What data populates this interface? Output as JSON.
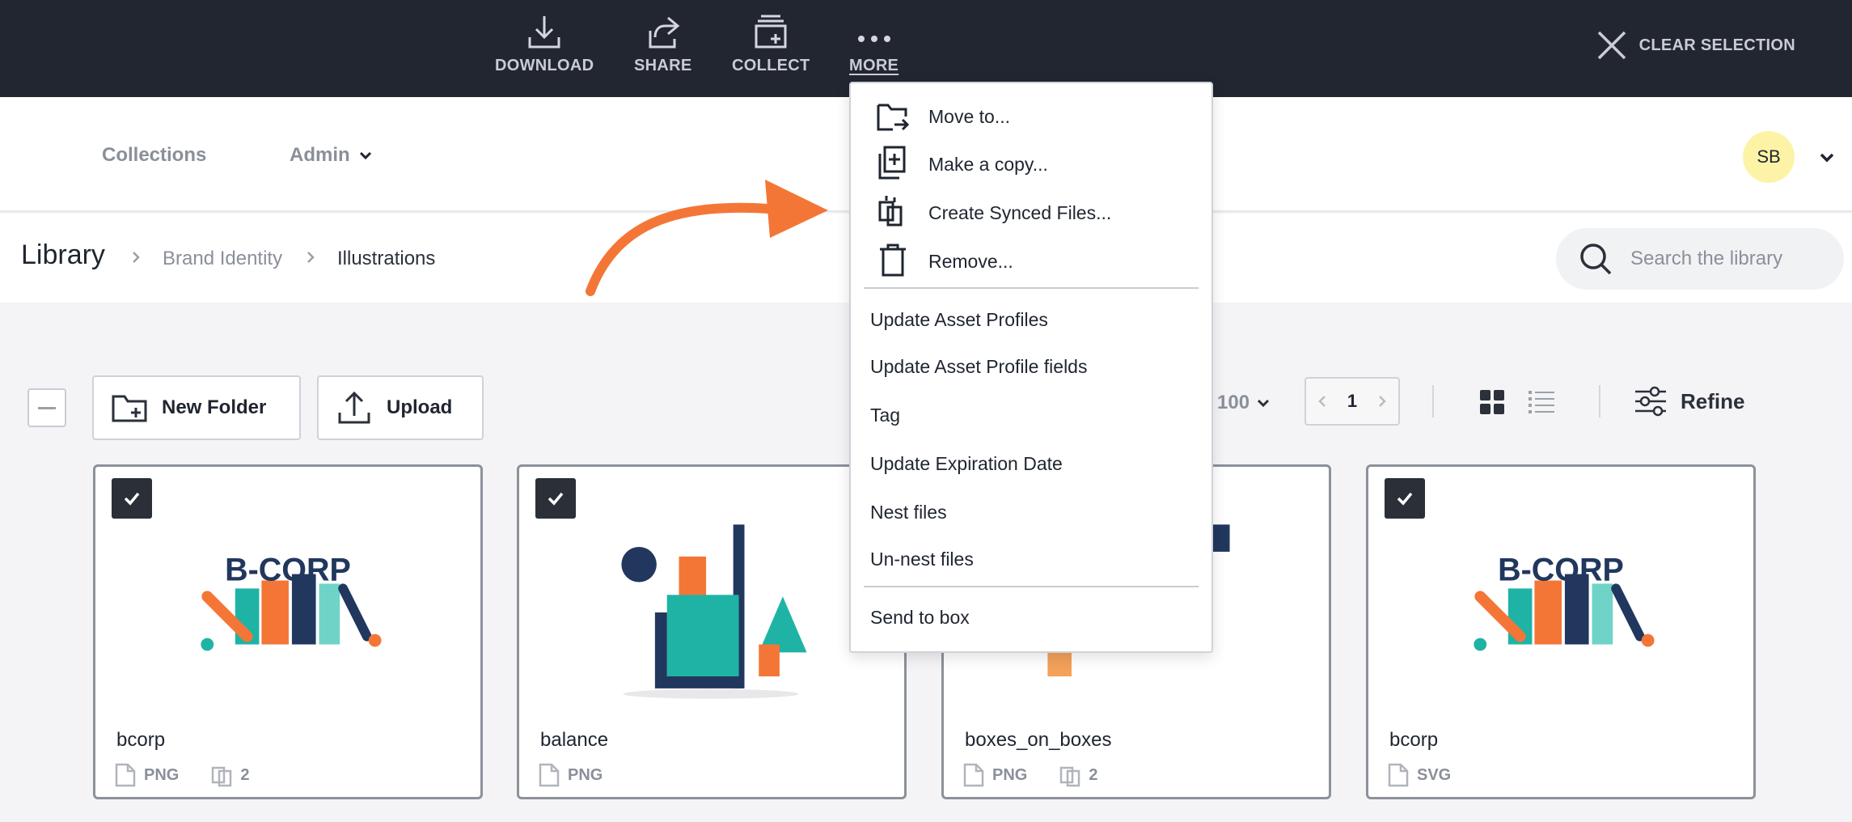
{
  "topbar": {
    "actions": {
      "download": "DOWNLOAD",
      "share": "SHARE",
      "collect": "COLLECT",
      "more": "MORE"
    },
    "clear_selection": "CLEAR SELECTION"
  },
  "nav": {
    "collections": "Collections",
    "admin": "Admin",
    "user_initials": "SB"
  },
  "breadcrumb": {
    "root": "Library",
    "parent": "Brand Identity",
    "current": "Illustrations"
  },
  "search": {
    "placeholder": "Search the library"
  },
  "toolbar": {
    "new_folder": "New Folder",
    "upload": "Upload",
    "per_page": "100",
    "page": "1",
    "refine": "Refine"
  },
  "menu": {
    "items": {
      "move": "Move to...",
      "copy": "Make a copy...",
      "synced": "Create Synced Files...",
      "remove": "Remove...",
      "update_profiles": "Update Asset Profiles",
      "update_profile_fields": "Update Asset Profile fields",
      "tag": "Tag",
      "update_expiration": "Update Expiration Date",
      "nest": "Nest files",
      "unnest": "Un-nest files",
      "send_box": "Send to box"
    }
  },
  "assets": [
    {
      "name": "bcorp",
      "type": "PNG",
      "synced": "2",
      "thumb_text": "B-CORP"
    },
    {
      "name": "balance",
      "type": "PNG"
    },
    {
      "name": "boxes_on_boxes",
      "type": "PNG",
      "synced": "2"
    },
    {
      "name": "bcorp",
      "type": "SVG",
      "thumb_text": "B-CORP"
    }
  ],
  "colors": {
    "topbar_bg": "#222631",
    "accent_orange": "#f47636",
    "avatar_bg": "#fdf3a6",
    "brand_navy": "#21375e",
    "brand_teal": "#1fb3a5"
  }
}
